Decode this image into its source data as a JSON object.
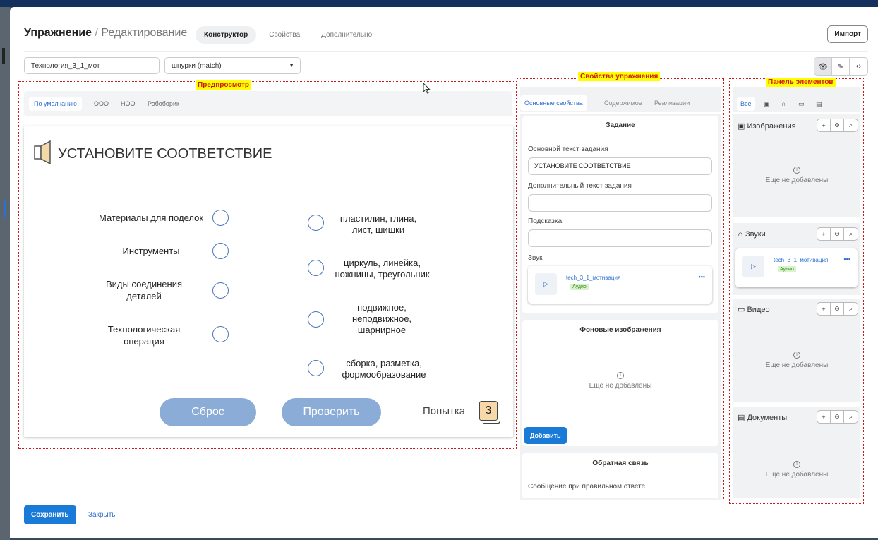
{
  "header": {
    "title_bold": "Упражнение",
    "title_sep": "/",
    "title_sub": "Редактирование",
    "tabs": [
      "Конструктор",
      "Свойства",
      "Дополнительно"
    ],
    "import_label": "Импорт"
  },
  "toolbar": {
    "exercise_name": "Технология_3_1_мот",
    "exercise_type": "шнурки (match)",
    "view_icons": [
      "eye-icon",
      "edit-icon",
      "code-icon"
    ]
  },
  "annotations": {
    "preview": "Предпросмотр",
    "properties": "Свойства упражнения",
    "elements": "Панель элементов"
  },
  "preview": {
    "tabs": [
      "По умолчанию",
      "ООО",
      "НОО",
      "Робоборик"
    ],
    "task_title": "УСТАНОВИТЕ СООТВЕТСТВИЕ",
    "left_items": [
      "Материалы для поделок",
      "Инструменты",
      "Виды соединения деталей",
      "Технологическая операция"
    ],
    "right_items": [
      "пластилин, глина, лист, шишки",
      "циркуль, линейка, ножницы, треугольник",
      "подвижное, неподвижное, шарнирное",
      "сборка, разметка, формообразование"
    ],
    "reset_label": "Сброс",
    "check_label": "Проверить",
    "attempt_label": "Попытка",
    "attempt_count": "3"
  },
  "properties": {
    "tabs": [
      "Основные свойства",
      "Содержимое",
      "Реализации"
    ],
    "task_section": "Задание",
    "main_text_label": "Основной текст задания",
    "main_text_value": "УСТАНОВИТЕ СООТВЕТСТВИЕ",
    "extra_text_label": "Дополнительный текст задания",
    "hint_label": "Подсказка",
    "sound_label": "Звук",
    "sound_file": "tech_3_1_мотивация",
    "sound_badge": "Аудио",
    "bg_section": "Фоновые изображения",
    "bg_empty": "Еще не добавлены",
    "add_label": "Добавить",
    "feedback_section": "Обратная связь",
    "correct_msg_label": "Сообщение при правильном ответе"
  },
  "elements": {
    "tab_all": "Все",
    "tab_icons": [
      "image-icon",
      "headphones-icon",
      "video-icon",
      "document-icon"
    ],
    "images_label": "Изображения",
    "sounds_label": "Звуки",
    "video_label": "Видео",
    "docs_label": "Документы",
    "empty_text": "Еще не добавлены",
    "sound_file": "tech_3_1_мотивация",
    "sound_badge": "Аудио"
  },
  "footer": {
    "save_label": "Сохранить",
    "close_label": "Закрыть"
  },
  "colors": {
    "accent": "#1a7ad8",
    "preview_button": "#8bacd6",
    "annotation_bg": "#ffff00",
    "annotation_text": "#d01818"
  }
}
